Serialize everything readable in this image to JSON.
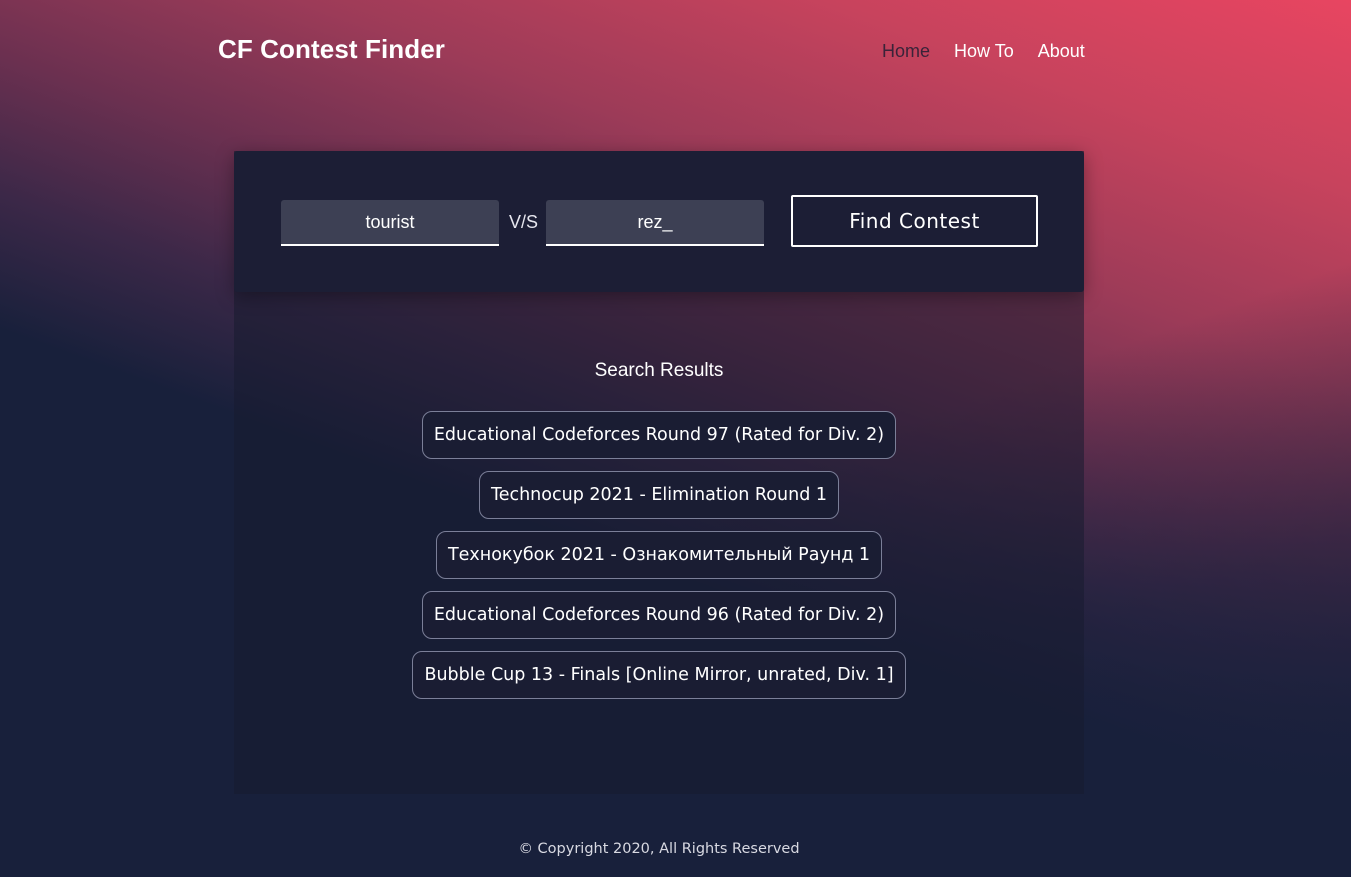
{
  "header": {
    "brand": "CF Contest Finder",
    "nav": [
      {
        "label": "Home",
        "active": true
      },
      {
        "label": "How To",
        "active": false
      },
      {
        "label": "About",
        "active": false
      }
    ]
  },
  "search": {
    "handle1_value": "tourist",
    "separator": "V/S",
    "handle2_value": "rez_",
    "button_label": "Find Contest"
  },
  "results": {
    "title": "Search Results",
    "items": [
      "Educational Codeforces Round 97 (Rated for Div. 2)",
      "Technocup 2021 - Elimination Round 1",
      "Технокубок 2021 - Ознакомительный Раунд 1",
      "Educational Codeforces Round 96 (Rated for Div. 2)",
      "Bubble Cup 13 - Finals [Online Mirror, unrated, Div. 1]"
    ]
  },
  "footer": {
    "text": "© Copyright 2020, All Rights Reserved"
  },
  "colors": {
    "accent_pink": "#e84561",
    "background_navy": "#18203b",
    "panel_dark": "#1c1e35",
    "input_bg": "#3d4054"
  }
}
